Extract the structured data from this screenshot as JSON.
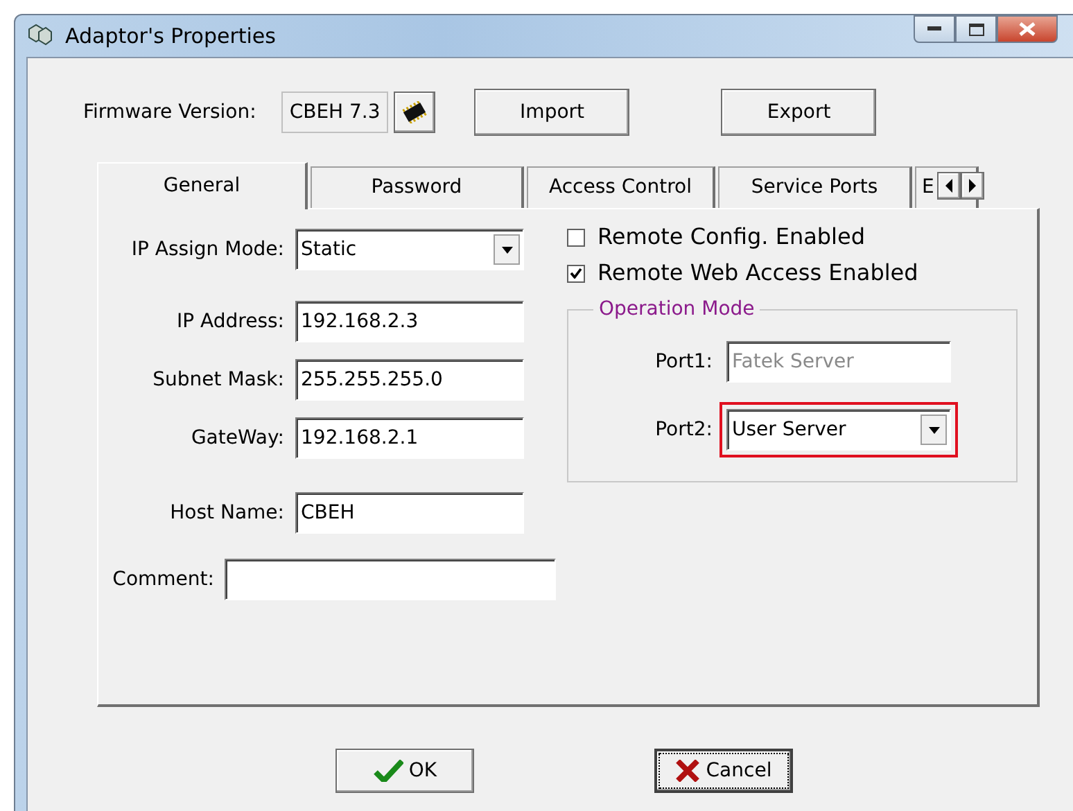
{
  "window": {
    "title": "Adaptor's Properties"
  },
  "firmware": {
    "label": "Firmware Version:",
    "value": "CBEH 7.3"
  },
  "top_buttons": [
    "Import",
    "Export"
  ],
  "tabs": [
    {
      "label": "General",
      "selected": true
    },
    {
      "label": "Password",
      "selected": false
    },
    {
      "label": "Access Control",
      "selected": false
    },
    {
      "label": "Service Ports",
      "selected": false
    },
    {
      "label": "E",
      "selected": false
    }
  ],
  "fields": [
    {
      "kind": "dropdown",
      "label": "IP Assign Mode:",
      "value": "Static"
    },
    {
      "kind": "text",
      "label": "IP Address:",
      "value": "192.168.2.3"
    },
    {
      "kind": "text",
      "label": "Subnet Mask:",
      "value": "255.255.255.0"
    },
    {
      "kind": "text",
      "label": "GateWay:",
      "value": "192.168.2.1"
    },
    {
      "kind": "text",
      "label": "Host Name:",
      "value": "CBEH"
    },
    {
      "kind": "wide",
      "label": "Comment:"
    }
  ],
  "checkboxes": [
    {
      "label": "Remote Config. Enabled",
      "checked": false
    },
    {
      "label": "Remote Web Access Enabled",
      "checked": true
    }
  ],
  "operation_mode": {
    "title": "Operation Mode",
    "ports": [
      {
        "kind": "text",
        "label": "Port1:",
        "value": "Fatek Server",
        "disabled": true,
        "highlighted": false
      },
      {
        "kind": "dropdown",
        "label": "Port2:",
        "value": "User Server",
        "disabled": false,
        "highlighted": true
      }
    ]
  },
  "footer_buttons": [
    {
      "kind": "ok",
      "label": "OK",
      "focused": false
    },
    {
      "kind": "cancel",
      "label": "Cancel",
      "focused": true
    }
  ]
}
